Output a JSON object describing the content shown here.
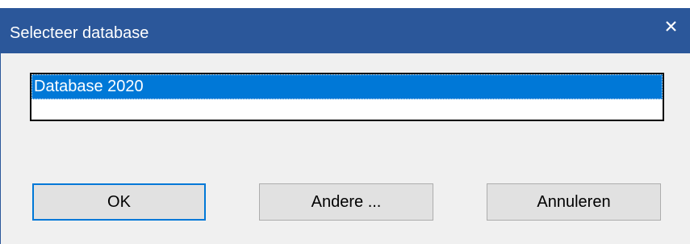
{
  "window": {
    "title": "Selecteer database",
    "close_label": "×"
  },
  "colors": {
    "titlebar": "#2b579a",
    "selection": "#0078d7",
    "dialog_background": "#f0f0f0",
    "button_face": "#e1e1e1",
    "button_border": "#adadad",
    "default_button_border": "#0078d7"
  },
  "database_list": {
    "items": [
      {
        "label": "Database 2020",
        "selected": true
      }
    ]
  },
  "buttons": {
    "ok_label": "OK",
    "other_label": "Andere ...",
    "cancel_label": "Annuleren"
  },
  "icons": {
    "close": "close-icon"
  }
}
